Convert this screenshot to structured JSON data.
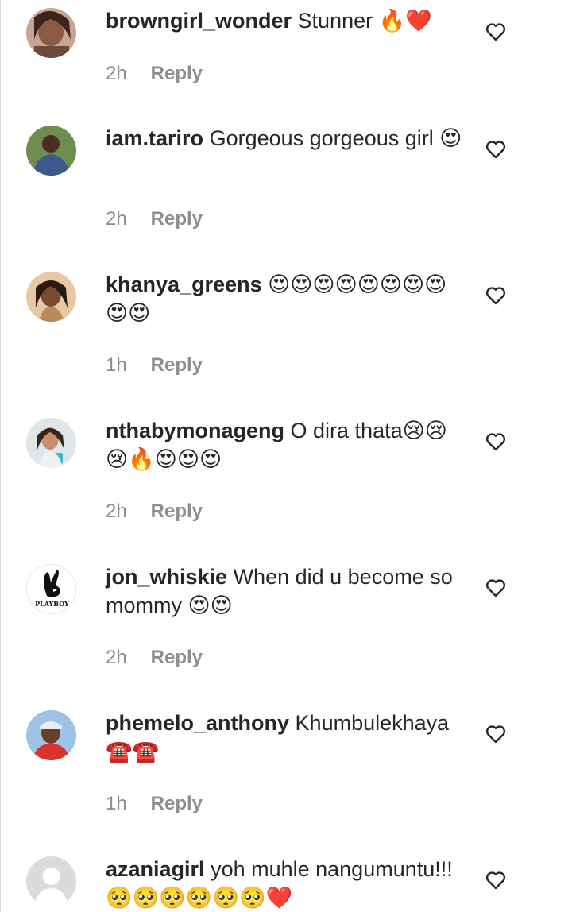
{
  "comments": [
    {
      "username": "browngirl_wonder",
      "text": "Stunner 🔥❤️",
      "time": "2h",
      "reply_label": "Reply",
      "avatar_icon": "profile-photo",
      "like_icon": "heart-outline-icon"
    },
    {
      "username": "iam.tariro",
      "text": "Gorgeous gorgeous girl 😍",
      "time": "2h",
      "reply_label": "Reply",
      "avatar_icon": "profile-photo",
      "like_icon": "heart-outline-icon"
    },
    {
      "username": "khanya_greens",
      "text": "😍😍😍😍😍😍😍😍😍😍",
      "time": "1h",
      "reply_label": "Reply",
      "avatar_icon": "profile-photo",
      "like_icon": "heart-outline-icon"
    },
    {
      "username": "nthabymonageng",
      "text": "O dira thata😢😢😢🔥😍😍😍",
      "time": "2h",
      "reply_label": "Reply",
      "avatar_icon": "profile-photo",
      "like_icon": "heart-outline-icon"
    },
    {
      "username": "jon_whiskie",
      "text": "When did u become so mommy 😍😍",
      "time": "2h",
      "reply_label": "Reply",
      "avatar_text": "PLAYBOY",
      "avatar_icon": "playboy-bunny-logo",
      "like_icon": "heart-outline-icon"
    },
    {
      "username": "phemelo_anthony",
      "text": "Khumbulekhaya ☎️☎️",
      "time": "1h",
      "reply_label": "Reply",
      "avatar_icon": "profile-photo",
      "like_icon": "heart-outline-icon"
    },
    {
      "username": "azaniagirl",
      "text": "yoh muhle nangumuntu!!! 🥺🥺🥺🥺🥺🥺❤️",
      "time": "",
      "reply_label": "",
      "avatar_icon": "default-avatar",
      "like_icon": "heart-outline-icon"
    }
  ]
}
